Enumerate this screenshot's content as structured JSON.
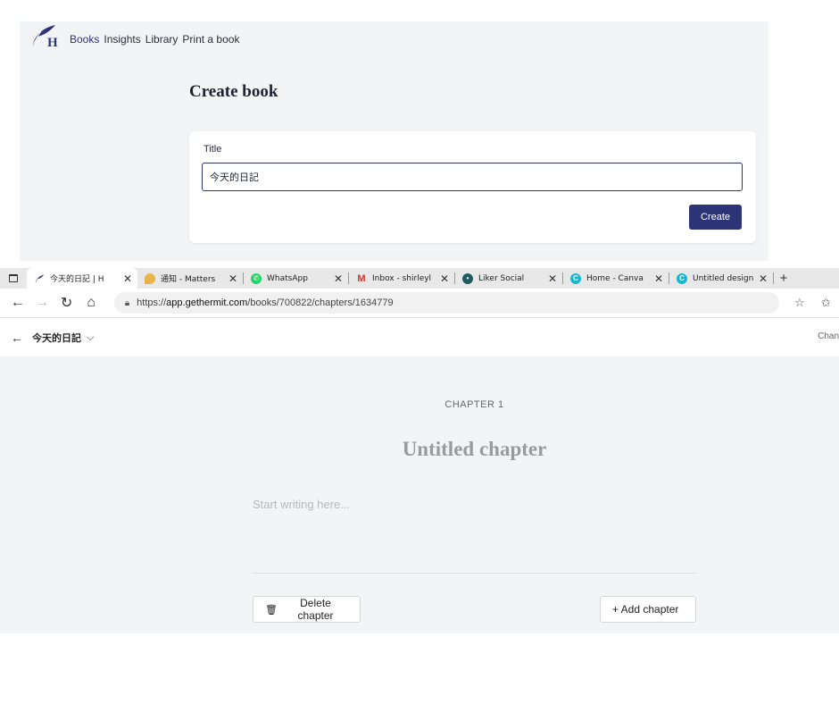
{
  "app": {
    "nav": [
      "Books",
      "Insights",
      "Library",
      "Print a book"
    ],
    "create_title": "Create book",
    "form": {
      "title_label": "Title",
      "title_value": "今天的日記",
      "create_button": "Create"
    }
  },
  "browser": {
    "tabs": [
      {
        "title": "今天的日記 | H",
        "active": true
      },
      {
        "title": "通知 - Matters"
      },
      {
        "title": "WhatsApp"
      },
      {
        "title": "Inbox - shirleyl"
      },
      {
        "title": "Liker Social"
      },
      {
        "title": "Home - Canva"
      },
      {
        "title": "Untitled design"
      }
    ],
    "url_scheme": "https://",
    "url_host": "app.gethermit.com",
    "url_path": "/books/700822/chapters/1634779"
  },
  "editor": {
    "book_title": "今天的日記",
    "changes": "Chan",
    "chapter_number": "CHAPTER 1",
    "chapter_title": "Untitled chapter",
    "placeholder": "Start writing here...",
    "delete_button": "Delete chapter",
    "add_button": "+ Add chapter"
  },
  "colors": {
    "brand": "#2d3377",
    "panel_bg": "#f3f4f6"
  },
  "icons": [
    "feather-logo-icon",
    "lock-icon",
    "trash-icon",
    "chevron-down-icon",
    "arrow-left-icon"
  ]
}
